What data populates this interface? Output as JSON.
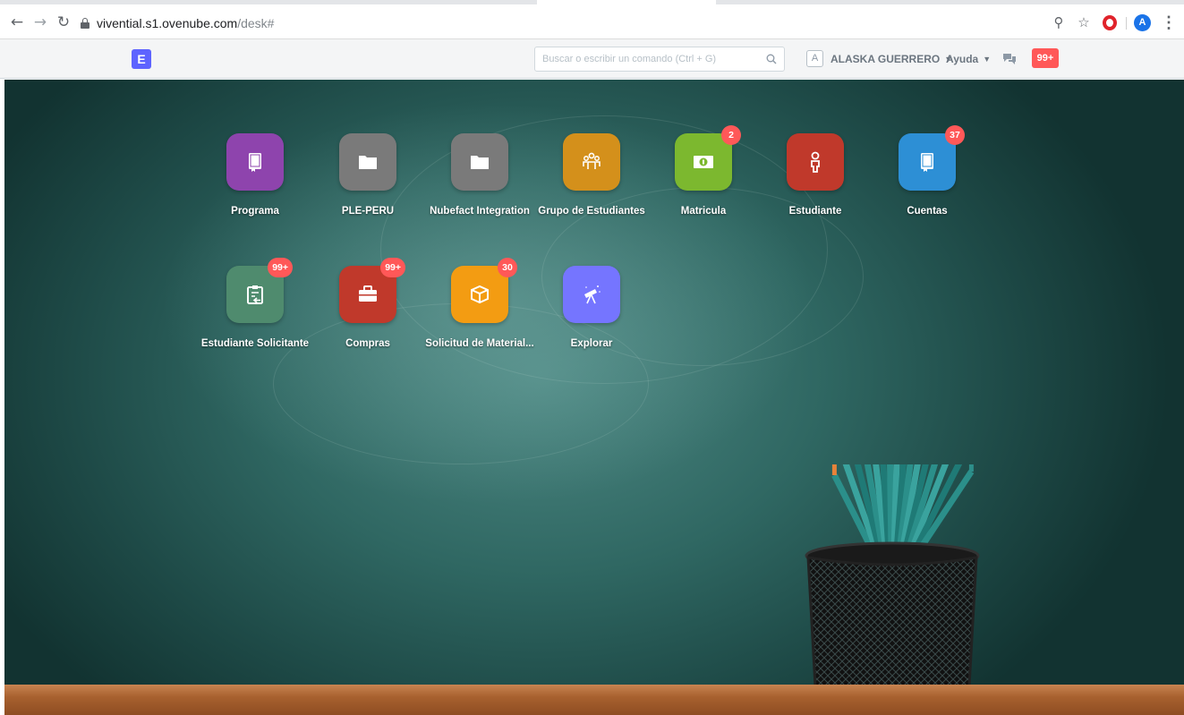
{
  "browser": {
    "url_host": "vivential.s1.ovenube.com",
    "url_path": "/desk#",
    "profile_initial": "A"
  },
  "navbar": {
    "logo_letter": "E",
    "search_placeholder": "Buscar o escribir un comando (Ctrl + G)",
    "avatar_initial": "A",
    "user_name": "ALASKA GUERRERO",
    "help_label": "Ayuda",
    "notifications_count": "99+"
  },
  "modules": [
    {
      "label": "Programa",
      "color": "#8e44ad",
      "icon": "book-icon",
      "badge": ""
    },
    {
      "label": "PLE-PERU",
      "color": "#7a7a7a",
      "icon": "folder-icon",
      "badge": ""
    },
    {
      "label": "Nubefact Integration",
      "color": "#7a7a7a",
      "icon": "folder-icon",
      "badge": ""
    },
    {
      "label": "Grupo de Estudiantes",
      "color": "#d4901b",
      "icon": "group-icon",
      "badge": ""
    },
    {
      "label": "Matricula",
      "color": "#7cb82f",
      "icon": "money-icon",
      "badge": "2"
    },
    {
      "label": "Estudiante",
      "color": "#c0392b",
      "icon": "person-icon",
      "badge": ""
    },
    {
      "label": "Cuentas",
      "color": "#2d8fd5",
      "icon": "book-icon",
      "badge": "37"
    },
    {
      "label": "Estudiante Solicitante",
      "color": "#4f8b6e",
      "icon": "clipboard-icon",
      "badge": "99+"
    },
    {
      "label": "Compras",
      "color": "#c0392b",
      "icon": "briefcase-icon",
      "badge": "99+"
    },
    {
      "label": "Solicitud de Material...",
      "color": "#f39c12",
      "icon": "box-icon",
      "badge": "30"
    },
    {
      "label": "Explorar",
      "color": "#7575ff",
      "icon": "telescope-icon",
      "badge": ""
    }
  ]
}
